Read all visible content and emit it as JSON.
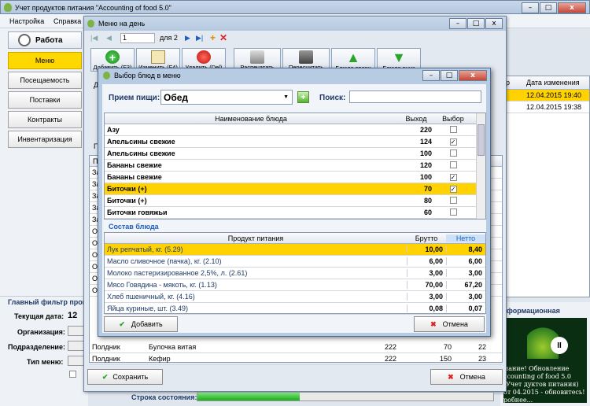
{
  "main": {
    "title": "Учет продуктов питания \"Accounting of food 5.0\"",
    "menu": [
      "Настройка",
      "Справка"
    ],
    "nav_header": "Работа",
    "nav_items": [
      "Меню",
      "Посещаемость",
      "Поставки",
      "Контракты",
      "Инвентаризация"
    ],
    "filter_title": "Главный фильтр прог",
    "date_label": "Текущая дата:",
    "date_value": "12",
    "org_label": "Организация:",
    "subdiv_label": "Подразделение:",
    "menutype_label": "Тип меню:",
    "right_cols": [
      "р",
      "Дата изменения"
    ],
    "right_rows": [
      [
        "12.04.2015 19:40"
      ],
      [
        "12.04.2015 19:38"
      ]
    ],
    "info_title": "формационная",
    "info_text": "мание! Обновление ccounting of food 5.0 (Учет дуктов питания) от 04.2015 - обновитесь! робнее..."
  },
  "day": {
    "title": "Меню на день",
    "page": "1",
    "of": "для 2",
    "toolbar": [
      "Добавить (F3)",
      "Изменить (F4)",
      "Удалить (Del)",
      "Распечатать",
      "Пересчитать",
      "Блюдо вверх",
      "Блюдо вниз"
    ],
    "left_labels": [
      "Д",
      "Г",
      "Пр"
    ],
    "left_rows": [
      "Зав",
      "Зав",
      "Зав",
      "Зав",
      "Зав",
      "Об",
      "Об",
      "Об",
      "Об",
      "Об",
      "Об"
    ],
    "bottom_rows": [
      [
        "Полдник",
        "Булочка витая",
        "222",
        "70",
        "22"
      ],
      [
        "Полдник",
        "Кефир",
        "222",
        "150",
        "23"
      ]
    ],
    "save": "Сохранить",
    "cancel": "Отмена",
    "status_label": "Строка состояния:"
  },
  "dlg": {
    "title": "Выбор блюд в меню",
    "meal_label": "Прием пищи:",
    "meal_value": "Обед",
    "search_label": "Поиск:",
    "dish_cols": [
      "Наименование блюда",
      "Выход",
      "Выбор"
    ],
    "dishes": [
      {
        "name": "Азу",
        "out": "220",
        "chk": ""
      },
      {
        "name": "Апельсины свежие",
        "out": "124",
        "chk": "✓"
      },
      {
        "name": "Апельсины свежие",
        "out": "100",
        "chk": ""
      },
      {
        "name": "Бананы свежие",
        "out": "120",
        "chk": ""
      },
      {
        "name": "Бананы свежие",
        "out": "100",
        "chk": "✓"
      },
      {
        "name": "Биточки (+)",
        "out": "70",
        "chk": "✓"
      },
      {
        "name": "Биточки (+)",
        "out": "80",
        "chk": ""
      },
      {
        "name": "Биточки говяжьи",
        "out": "60",
        "chk": ""
      }
    ],
    "comp_title": "Состав блюда",
    "comp_cols": [
      "Продукт питания",
      "Брутто",
      "Нетто"
    ],
    "comp": [
      {
        "p": "Лук репчатый, кг. (5.29)",
        "b": "10,00",
        "n": "8,40"
      },
      {
        "p": "Масло сливочное (пачка), кг. (2.10)",
        "b": "6,00",
        "n": "6,00"
      },
      {
        "p": "Молоко пастеризированное 2,5%, л. (2.61)",
        "b": "3,00",
        "n": "3,00"
      },
      {
        "p": "Мясо Говядина - мякоть, кг. (1.13)",
        "b": "70,00",
        "n": "67,20"
      },
      {
        "p": "Хлеб пшеничный, кг. (4.16)",
        "b": "3,00",
        "n": "3,00"
      },
      {
        "p": "Яйца куриные, шт. (3.49)",
        "b": "0,08",
        "n": "0,07"
      }
    ],
    "add": "Добавить",
    "cancel": "Отмена"
  },
  "colors": {
    "accent": "#ffd200",
    "dialog_frame": "#b4c8df"
  }
}
